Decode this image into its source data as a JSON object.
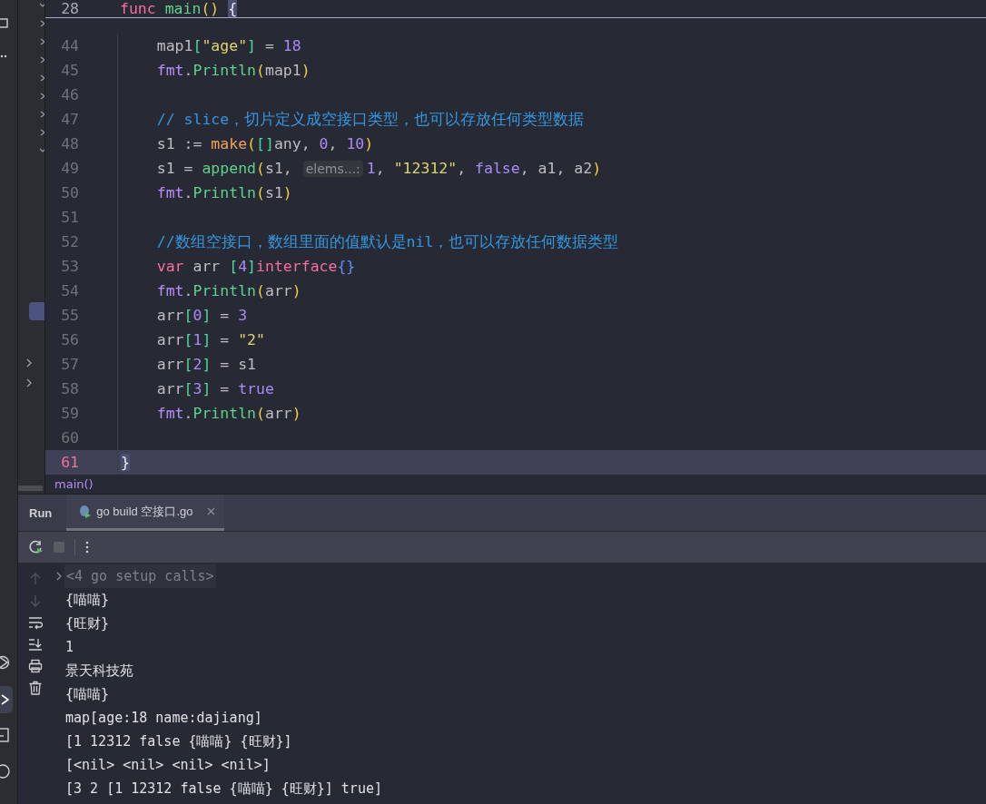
{
  "editor": {
    "sticky_header": {
      "number": "28",
      "tokens": [
        {
          "kind": "keyword",
          "text": "func "
        },
        {
          "kind": "call",
          "text": "main"
        },
        {
          "kind": "bracket-1",
          "text": "() "
        },
        {
          "kind": "brace-matched",
          "text": "{"
        }
      ]
    },
    "lines": [
      {
        "number": "44",
        "current": false,
        "tokens": [
          {
            "kind": "plain",
            "text": "    map1"
          },
          {
            "kind": "bracket-2",
            "text": "["
          },
          {
            "kind": "string",
            "text": "\"age\""
          },
          {
            "kind": "bracket-2",
            "text": "]"
          },
          {
            "kind": "plain",
            "text": " = "
          },
          {
            "kind": "number",
            "text": "18"
          }
        ]
      },
      {
        "number": "45",
        "current": false,
        "tokens": [
          {
            "kind": "package",
            "text": "    fmt"
          },
          {
            "kind": "plain",
            "text": "."
          },
          {
            "kind": "call",
            "text": "Println"
          },
          {
            "kind": "bracket-1",
            "text": "("
          },
          {
            "kind": "plain",
            "text": "map1"
          },
          {
            "kind": "bracket-1",
            "text": ")"
          }
        ]
      },
      {
        "number": "46",
        "current": false
      },
      {
        "number": "47",
        "current": false,
        "tokens": [
          {
            "kind": "comment",
            "text": "    // slice，切片定义成空接口类型，也可以存放任何类型数据"
          }
        ]
      },
      {
        "number": "48",
        "current": false,
        "tokens": [
          {
            "kind": "plain",
            "text": "    s1 := "
          },
          {
            "kind": "builtin",
            "text": "make"
          },
          {
            "kind": "bracket-1",
            "text": "("
          },
          {
            "kind": "bracket-2",
            "text": "[]"
          },
          {
            "kind": "plain",
            "text": "any, "
          },
          {
            "kind": "number",
            "text": "0"
          },
          {
            "kind": "plain",
            "text": ", "
          },
          {
            "kind": "number",
            "text": "10"
          },
          {
            "kind": "bracket-1",
            "text": ")"
          }
        ]
      },
      {
        "number": "49",
        "current": false,
        "tokens": [
          {
            "kind": "plain",
            "text": "    s1 = "
          },
          {
            "kind": "call",
            "text": "append"
          },
          {
            "kind": "bracket-1",
            "text": "("
          },
          {
            "kind": "plain",
            "text": "s1, "
          },
          {
            "kind": "hint",
            "text": "elems...:"
          },
          {
            "kind": "number",
            "text": "1"
          },
          {
            "kind": "plain",
            "text": ", "
          },
          {
            "kind": "string",
            "text": "\"12312\""
          },
          {
            "kind": "plain",
            "text": ", "
          },
          {
            "kind": "constant",
            "text": "false"
          },
          {
            "kind": "plain",
            "text": ", a1, a2"
          },
          {
            "kind": "bracket-1",
            "text": ")"
          }
        ]
      },
      {
        "number": "50",
        "current": false,
        "tokens": [
          {
            "kind": "package",
            "text": "    fmt"
          },
          {
            "kind": "plain",
            "text": "."
          },
          {
            "kind": "call",
            "text": "Println"
          },
          {
            "kind": "bracket-1",
            "text": "("
          },
          {
            "kind": "plain",
            "text": "s1"
          },
          {
            "kind": "bracket-1",
            "text": ")"
          }
        ]
      },
      {
        "number": "51",
        "current": false
      },
      {
        "number": "52",
        "current": false,
        "tokens": [
          {
            "kind": "comment",
            "text": "    //数组空接口，数组里面的值默认是nil，也可以存放任何数据类型"
          }
        ]
      },
      {
        "number": "53",
        "current": false,
        "tokens": [
          {
            "kind": "keyword",
            "text": "    var"
          },
          {
            "kind": "plain",
            "text": " arr "
          },
          {
            "kind": "bracket-2",
            "text": "["
          },
          {
            "kind": "number",
            "text": "4"
          },
          {
            "kind": "bracket-2",
            "text": "]"
          },
          {
            "kind": "keyword",
            "text": "interface"
          },
          {
            "kind": "bracket-3",
            "text": "{}"
          }
        ]
      },
      {
        "number": "54",
        "current": false,
        "tokens": [
          {
            "kind": "package",
            "text": "    fmt"
          },
          {
            "kind": "plain",
            "text": "."
          },
          {
            "kind": "call",
            "text": "Println"
          },
          {
            "kind": "bracket-1",
            "text": "("
          },
          {
            "kind": "plain",
            "text": "arr"
          },
          {
            "kind": "bracket-1",
            "text": ")"
          }
        ]
      },
      {
        "number": "55",
        "current": false,
        "tokens": [
          {
            "kind": "plain",
            "text": "    arr"
          },
          {
            "kind": "bracket-2",
            "text": "["
          },
          {
            "kind": "number",
            "text": "0"
          },
          {
            "kind": "bracket-2",
            "text": "]"
          },
          {
            "kind": "plain",
            "text": " = "
          },
          {
            "kind": "number",
            "text": "3"
          }
        ]
      },
      {
        "number": "56",
        "current": false,
        "tokens": [
          {
            "kind": "plain",
            "text": "    arr"
          },
          {
            "kind": "bracket-2",
            "text": "["
          },
          {
            "kind": "number",
            "text": "1"
          },
          {
            "kind": "bracket-2",
            "text": "]"
          },
          {
            "kind": "plain",
            "text": " = "
          },
          {
            "kind": "string",
            "text": "\"2\""
          }
        ]
      },
      {
        "number": "57",
        "current": false,
        "tokens": [
          {
            "kind": "plain",
            "text": "    arr"
          },
          {
            "kind": "bracket-2",
            "text": "["
          },
          {
            "kind": "number",
            "text": "2"
          },
          {
            "kind": "bracket-2",
            "text": "]"
          },
          {
            "kind": "plain",
            "text": " = s1"
          }
        ]
      },
      {
        "number": "58",
        "current": false,
        "tokens": [
          {
            "kind": "plain",
            "text": "    arr"
          },
          {
            "kind": "bracket-2",
            "text": "["
          },
          {
            "kind": "number",
            "text": "3"
          },
          {
            "kind": "bracket-2",
            "text": "]"
          },
          {
            "kind": "plain",
            "text": " = "
          },
          {
            "kind": "constant",
            "text": "true"
          }
        ]
      },
      {
        "number": "59",
        "current": false,
        "tokens": [
          {
            "kind": "package",
            "text": "    fmt"
          },
          {
            "kind": "plain",
            "text": "."
          },
          {
            "kind": "call",
            "text": "Println"
          },
          {
            "kind": "bracket-1",
            "text": "("
          },
          {
            "kind": "plain",
            "text": "arr"
          },
          {
            "kind": "bracket-1",
            "text": ")"
          }
        ]
      },
      {
        "number": "60",
        "current": false
      },
      {
        "number": "61",
        "current": true,
        "tokens": [
          {
            "kind": "brace-matched",
            "text": "}"
          }
        ]
      }
    ],
    "breadcrumb": "main()"
  },
  "run_panel": {
    "title": "Run",
    "tabs": [
      {
        "label": "go build 空接口.go",
        "selected": true
      }
    ],
    "console": {
      "fold": "<4 go setup calls>",
      "output": [
        "{喵喵}",
        "{旺财}",
        "1",
        "景天科技苑",
        "{喵喵}",
        "map[age:18 name:dajiang]",
        "[1 12312 false {喵喵} {旺财}]",
        "[<nil> <nil> <nil> <nil>]",
        "[3 2 [1 12312 false {喵喵} {旺财}] true]"
      ]
    }
  }
}
